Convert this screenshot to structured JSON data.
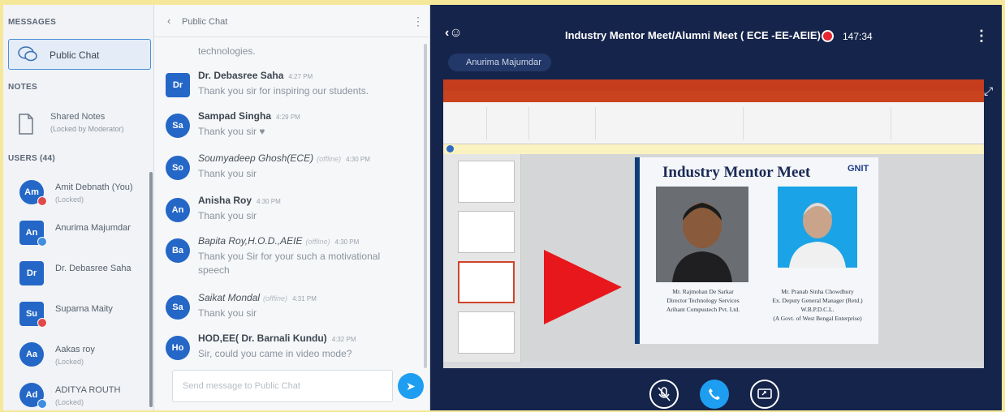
{
  "sidebar": {
    "messages_title": "MESSAGES",
    "public_chat_label": "Public Chat",
    "notes_title": "NOTES",
    "shared_notes_label": "Shared Notes",
    "shared_notes_sub": "(Locked by Moderator)",
    "users_title": "USERS (44)",
    "users": [
      {
        "initials": "Am",
        "name": "Amit Debnath (You)",
        "sub": "(Locked)",
        "status": "red",
        "shape": "round"
      },
      {
        "initials": "An",
        "name": "Anurima Majumdar",
        "sub": "",
        "status": "blue",
        "shape": "square"
      },
      {
        "initials": "Dr",
        "name": "Dr. Debasree Saha",
        "sub": "",
        "status": "",
        "shape": "square"
      },
      {
        "initials": "Su",
        "name": "Suparna Maity",
        "sub": "",
        "status": "red",
        "shape": "square"
      },
      {
        "initials": "Aa",
        "name": "Aakas roy",
        "sub": "(Locked)",
        "status": "",
        "shape": "round"
      },
      {
        "initials": "Ad",
        "name": "ADITYA ROUTH",
        "sub": "(Locked)",
        "status": "blue",
        "shape": "round"
      }
    ]
  },
  "chat": {
    "title": "Public Chat",
    "first_line": "technologies.",
    "messages": [
      {
        "initials": "Dr",
        "sender": "Dr. Debasree Saha",
        "time": "4:27 PM",
        "text": "Thank you sir for inspiring our students.",
        "offline": false,
        "shape": "square"
      },
      {
        "initials": "Sa",
        "sender": "Sampad Singha",
        "time": "4:29 PM",
        "text": "Thank you sir ♥",
        "offline": false,
        "shape": "round"
      },
      {
        "initials": "So",
        "sender": "Soumyadeep Ghosh(ECE)",
        "time": "4:30 PM",
        "text": "Thank you sir",
        "offline": true,
        "shape": "round"
      },
      {
        "initials": "An",
        "sender": "Anisha Roy",
        "time": "4:30 PM",
        "text": "Thank you sir",
        "offline": false,
        "shape": "round"
      },
      {
        "initials": "Ba",
        "sender": "Bapita Roy,H.O.D.,AEIE",
        "time": "4:30 PM",
        "text": "Thank you Sir for your such a motivational speech",
        "offline": true,
        "shape": "round"
      },
      {
        "initials": "Sa",
        "sender": "Saikat Mondal",
        "time": "4:31 PM",
        "text": "Thank you sir",
        "offline": true,
        "shape": "round"
      },
      {
        "initials": "Ho",
        "sender": "HOD,EE( Dr. Barnali Kundu)",
        "time": "4:32 PM",
        "text": "Sir, could you came in video mode?",
        "offline": false,
        "shape": "round"
      }
    ],
    "offline_tag": "(offline)",
    "input_placeholder": "Send message to Public Chat"
  },
  "presentation": {
    "meeting_title": "Industry Mentor Meet/Alumni Meet ( ECE -EE-AEIE)",
    "rec_time": "147:34",
    "presenter": "Anurima Majumdar",
    "slide_heading": "Industry Mentor Meet",
    "slide_logo": "GNIT",
    "person1": [
      "Mr. Rajmohan De Sarkar",
      "Director Technology Services",
      "Arihant Compustech Pvt. Ltd."
    ],
    "person2": [
      "Mr. Pranab Sinha Chowdhury",
      "Ex. Deputy General Manager (Retd.)",
      "W.B.P.D.C.L.",
      "(A Govt. of West Bengal Enterprise)"
    ]
  },
  "colors": {
    "accent": "#1e9ef0",
    "avatar": "#2467c7",
    "play": "#e8171c",
    "pres_bg": "#15244a",
    "ppt_red": "#c63d1e"
  }
}
